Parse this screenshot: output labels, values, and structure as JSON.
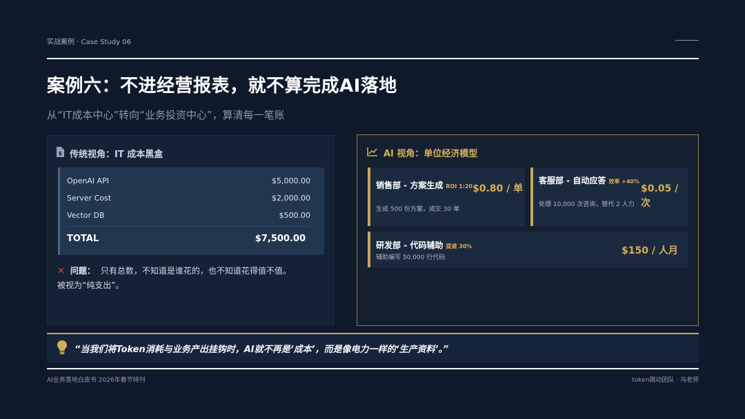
{
  "header": {
    "kicker": "实战案例 · Case Study 06",
    "title": "案例六：不进经营报表，就不算完成AI落地",
    "subtitle": "从“IT成本中心”转向“业务投资中心”，算清每一笔账"
  },
  "left_panel": {
    "heading": "传统视角：IT 成本黑盒",
    "icon": "document-dollar-icon",
    "rows": [
      {
        "label": "OpenAI API",
        "value": "$5,000.00"
      },
      {
        "label": "Server Cost",
        "value": "$2,000.00"
      },
      {
        "label": "Vector DB",
        "value": "$500.00"
      }
    ],
    "total": {
      "label": "TOTAL",
      "value": "$7,500.00"
    },
    "problem": {
      "label": "问题：",
      "line1": "只有总数，不知道是谁花的，也不知道花得值不值。",
      "line2": "被视为“纯支出”。"
    }
  },
  "right_panel": {
    "heading": "AI 视角：单位经济模型",
    "icon": "line-chart-icon",
    "cards": [
      {
        "title": "销售部 - 方案生成",
        "tag": "ROI 1:20",
        "desc": "生成 500 份方案，成交 30 单",
        "price": "$0.80 / 单"
      },
      {
        "title": "客服部 - 自动应答",
        "tag": "效率 +40%",
        "desc": "处理 10,000 次咨询，替代 2 人力",
        "price_line1": "$0.05 /",
        "price_line2": "次"
      },
      {
        "title": "研发部 - 代码辅助",
        "tag": "提速 30%",
        "desc": "辅助编写 50,000 行代码",
        "price": "$150 / 人月"
      }
    ]
  },
  "quote": {
    "icon": "lightbulb-icon",
    "text": "“当我们将Token消耗与业务产出挂钩时，AI就不再是‘成本’，而是像电力一样的‘生产资料’。”"
  },
  "footer": {
    "left": "AI业务落地白皮书 2026年春节特刊",
    "right": "token跳动团队 · 马老师"
  },
  "colors": {
    "background": "#0e1a2b",
    "accent_gold": "#d6ae5a",
    "alert_red": "#d9434b"
  }
}
